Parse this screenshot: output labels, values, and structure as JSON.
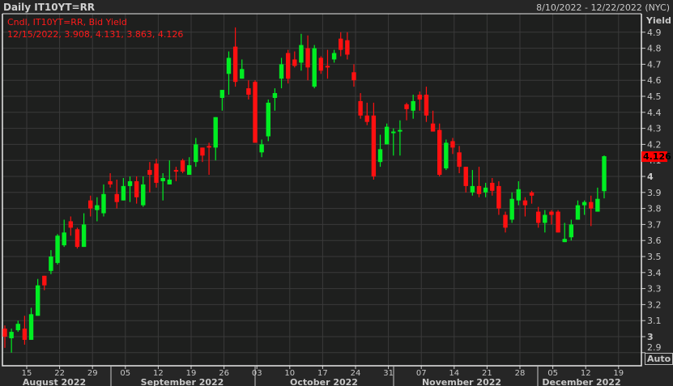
{
  "header": {
    "title": "Daily IT10YT=RR",
    "range": "8/10/2022 - 12/22/2022 (NYC)"
  },
  "legend": {
    "line1": "Cndl, IT10YT=RR, Bid Yield",
    "line2": "12/15/2022, 3.908, 4.131, 3.863, 4.126"
  },
  "axis": {
    "y_title": "Yield",
    "y_ticks": [
      "4.9",
      "4.8",
      "4.7",
      "4.6",
      "4.5",
      "4.4",
      "4.3",
      "4.2",
      "4.1",
      "4",
      "3.9",
      "3.8",
      "3.7",
      "3.6",
      "3.5",
      "3.4",
      "3.3",
      "3.2",
      "3.1",
      "3",
      "2.9"
    ],
    "x_days": [
      "15",
      "22",
      "29",
      "05",
      "12",
      "19",
      "26",
      "03",
      "10",
      "17",
      "24",
      "31",
      "07",
      "14",
      "21",
      "28",
      "05",
      "12",
      "19"
    ],
    "months": [
      "August 2022",
      "September 2022",
      "October 2022",
      "November 2022",
      "December 2022"
    ],
    "auto_label": "Auto"
  },
  "last_price": {
    "label": "4.126",
    "value": 4.126
  },
  "colors": {
    "up": "#00ee22",
    "down": "#ff1010",
    "background": "#1e1f1e",
    "grid": "#3a3a3a",
    "tag": "#ff0000"
  },
  "chart_data": {
    "type": "candlestick",
    "symbol": "IT10YT=RR",
    "ylabel": "Yield",
    "ylim": [
      2.87,
      4.95
    ],
    "ohlc": [
      [
        3.05,
        3.07,
        2.93,
        3.0
      ],
      [
        2.99,
        3.05,
        2.9,
        3.03
      ],
      [
        3.04,
        3.1,
        3.03,
        3.08
      ],
      [
        3.05,
        3.13,
        2.95,
        2.98
      ],
      [
        2.98,
        3.18,
        2.98,
        3.14
      ],
      [
        3.13,
        3.36,
        3.13,
        3.32
      ],
      [
        3.38,
        3.38,
        3.29,
        3.32
      ],
      [
        3.41,
        3.54,
        3.39,
        3.5
      ],
      [
        3.46,
        3.64,
        3.45,
        3.63
      ],
      [
        3.57,
        3.73,
        3.56,
        3.65
      ],
      [
        3.72,
        3.75,
        3.63,
        3.68
      ],
      [
        3.67,
        3.68,
        3.55,
        3.56
      ],
      [
        3.56,
        3.77,
        3.56,
        3.7
      ],
      [
        3.85,
        3.88,
        3.75,
        3.8
      ],
      [
        3.79,
        3.87,
        3.72,
        3.82
      ],
      [
        3.77,
        3.95,
        3.75,
        3.89
      ],
      [
        3.97,
        4.02,
        3.93,
        3.95
      ],
      [
        3.89,
        3.98,
        3.8,
        3.84
      ],
      [
        3.85,
        3.99,
        3.85,
        3.94
      ],
      [
        3.94,
        4.0,
        3.84,
        3.97
      ],
      [
        3.97,
        4.0,
        3.83,
        3.87
      ],
      [
        3.82,
        4.0,
        3.81,
        3.95
      ],
      [
        4.04,
        4.09,
        3.9,
        4.01
      ],
      [
        4.08,
        4.11,
        3.93,
        3.96
      ],
      [
        3.97,
        4.02,
        3.85,
        3.99
      ],
      [
        3.95,
        4.1,
        3.95,
        3.98
      ],
      [
        4.04,
        4.06,
        3.97,
        4.03
      ],
      [
        4.1,
        4.11,
        4.02,
        4.03
      ],
      [
        4.01,
        4.12,
        4.01,
        4.07
      ],
      [
        4.09,
        4.24,
        4.06,
        4.2
      ],
      [
        4.18,
        4.18,
        4.09,
        4.13
      ],
      [
        4.19,
        4.21,
        4.01,
        4.18
      ],
      [
        4.18,
        4.37,
        4.1,
        4.37
      ],
      [
        4.49,
        4.54,
        4.41,
        4.54
      ],
      [
        4.64,
        4.78,
        4.51,
        4.74
      ],
      [
        4.81,
        4.93,
        4.56,
        4.59
      ],
      [
        4.61,
        4.73,
        4.61,
        4.67
      ],
      [
        4.55,
        4.6,
        4.48,
        4.51
      ],
      [
        4.59,
        4.6,
        4.21,
        4.21
      ],
      [
        4.15,
        4.23,
        4.12,
        4.2
      ],
      [
        4.25,
        4.48,
        4.22,
        4.46
      ],
      [
        4.49,
        4.55,
        4.41,
        4.52
      ],
      [
        4.61,
        4.74,
        4.55,
        4.7
      ],
      [
        4.77,
        4.79,
        4.58,
        4.61
      ],
      [
        4.73,
        4.78,
        4.68,
        4.69
      ],
      [
        4.71,
        4.89,
        4.66,
        4.82
      ],
      [
        4.8,
        4.88,
        4.6,
        4.68
      ],
      [
        4.56,
        4.82,
        4.55,
        4.8
      ],
      [
        4.74,
        4.75,
        4.64,
        4.66
      ],
      [
        4.69,
        4.79,
        4.61,
        4.68
      ],
      [
        4.73,
        4.79,
        4.71,
        4.77
      ],
      [
        4.86,
        4.9,
        4.75,
        4.79
      ],
      [
        4.85,
        4.9,
        4.73,
        4.76
      ],
      [
        4.65,
        4.7,
        4.56,
        4.6
      ],
      [
        4.47,
        4.52,
        4.36,
        4.38
      ],
      [
        4.38,
        4.46,
        4.32,
        4.34
      ],
      [
        4.38,
        4.46,
        3.98,
        4.0
      ],
      [
        4.09,
        4.26,
        4.06,
        4.17
      ],
      [
        4.2,
        4.33,
        4.2,
        4.31
      ],
      [
        4.28,
        4.3,
        4.13,
        4.28
      ],
      [
        4.28,
        4.35,
        4.13,
        4.29
      ],
      [
        4.45,
        4.46,
        4.35,
        4.42
      ],
      [
        4.41,
        4.51,
        4.36,
        4.47
      ],
      [
        4.51,
        4.53,
        4.41,
        4.48
      ],
      [
        4.51,
        4.56,
        4.34,
        4.38
      ],
      [
        4.33,
        4.41,
        4.28,
        4.28
      ],
      [
        4.29,
        4.33,
        4.0,
        4.01
      ],
      [
        4.05,
        4.23,
        4.04,
        4.21
      ],
      [
        4.22,
        4.24,
        4.14,
        4.18
      ],
      [
        4.15,
        4.19,
        4.02,
        4.06
      ],
      [
        4.06,
        4.06,
        3.9,
        3.94
      ],
      [
        3.9,
        4.04,
        3.88,
        3.94
      ],
      [
        3.94,
        4.06,
        3.87,
        3.89
      ],
      [
        3.9,
        3.96,
        3.87,
        3.93
      ],
      [
        3.96,
        3.99,
        3.88,
        3.91
      ],
      [
        3.94,
        3.97,
        3.76,
        3.8
      ],
      [
        3.76,
        3.78,
        3.65,
        3.68
      ],
      [
        3.73,
        3.9,
        3.71,
        3.86
      ],
      [
        3.85,
        3.97,
        3.82,
        3.92
      ],
      [
        3.85,
        3.87,
        3.75,
        3.82
      ],
      [
        3.9,
        3.91,
        3.83,
        3.88
      ],
      [
        3.78,
        3.81,
        3.68,
        3.71
      ],
      [
        3.71,
        3.79,
        3.65,
        3.76
      ],
      [
        3.78,
        3.79,
        3.7,
        3.76
      ],
      [
        3.78,
        3.79,
        3.65,
        3.65
      ],
      [
        3.59,
        3.71,
        3.59,
        3.61
      ],
      [
        3.62,
        3.73,
        3.6,
        3.7
      ],
      [
        3.73,
        3.85,
        3.73,
        3.82
      ],
      [
        3.82,
        3.85,
        3.76,
        3.84
      ],
      [
        3.84,
        3.88,
        3.69,
        3.8
      ],
      [
        3.78,
        3.93,
        3.78,
        3.86
      ],
      [
        3.908,
        4.131,
        3.863,
        4.126
      ]
    ]
  }
}
